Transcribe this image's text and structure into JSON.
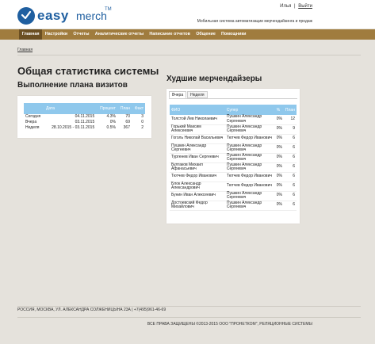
{
  "brand": {
    "easy": "easy",
    "merch": "merch",
    "tm": "TM",
    "primary_color": "#1f5fa0",
    "logo_icon": "check-circle-icon"
  },
  "header": {
    "user_name": "Илья",
    "separator": "|",
    "logout_label": "Выйти",
    "tagline": "Мобильная система автоматизации мерчендайзинга и продаж"
  },
  "nav": {
    "background": "#a07c3e",
    "active_background": "#6b4f22",
    "items": [
      {
        "label": "Главная",
        "active": true
      },
      {
        "label": "Настройки"
      },
      {
        "label": "Отчеты"
      },
      {
        "label": "Аналитические отчеты"
      },
      {
        "label": "Написание отчетов"
      },
      {
        "label": "Общение"
      },
      {
        "label": "Помощники"
      }
    ]
  },
  "breadcrumb": {
    "label": "Главная"
  },
  "page": {
    "title": "Общая статистика системы",
    "plan_title": "Выполнение плана визитов",
    "worst_title": "Худшие мерчендайзеры"
  },
  "plan_table": {
    "header_color": "#8fc8ec",
    "columns": [
      "",
      "Дата",
      "Процент",
      "План",
      "Факт"
    ],
    "rows": [
      {
        "period": "Сегодня",
        "date": "04.11.2015",
        "percent": "4.3%",
        "plan": "70",
        "fact": "3"
      },
      {
        "period": "Вчера",
        "date": "03.11.2015",
        "percent": "0%",
        "plan": "69",
        "fact": "0"
      },
      {
        "period": "Неделя",
        "date": "28.10.2015 - 03.11.2015",
        "percent": "0.5%",
        "plan": "367",
        "fact": "2"
      }
    ]
  },
  "worst": {
    "tabs": [
      {
        "label": "Вчера",
        "active": true
      },
      {
        "label": "Неделя"
      }
    ],
    "columns": [
      "ФИО",
      "Супер",
      "%",
      "План"
    ],
    "rows": [
      {
        "name": "Толстой Лев Николаевич",
        "super": "Пушкин Александр Сергеевич",
        "percent": "0%",
        "plan": "12"
      },
      {
        "name": "Горький Максим Алексеевич",
        "super": "Пушкин Александр Сергеевич",
        "percent": "0%",
        "plan": "9"
      },
      {
        "name": "Гоголь Николай Васильевич",
        "super": "Тютчев Федор Иванович",
        "percent": "0%",
        "plan": "6"
      },
      {
        "name": "Пушкин Александр Сергеевич",
        "super": "Пушкин Александр Сергеевич",
        "percent": "0%",
        "plan": "6"
      },
      {
        "name": "Тургенев Иван Сергеевич",
        "super": "Пушкин Александр Сергеевич",
        "percent": "0%",
        "plan": "6"
      },
      {
        "name": "Булгаков Михаил Афанасьевич",
        "super": "Пушкин Александр Сергеевич",
        "percent": "0%",
        "plan": "6"
      },
      {
        "name": "Тютчев Федор Иванович",
        "super": "Тютчев Федор Иванович",
        "percent": "0%",
        "plan": "6"
      },
      {
        "name": "Блок Александр Александрович",
        "super": "Тютчев Федор Иванович",
        "percent": "0%",
        "plan": "6"
      },
      {
        "name": "Бунин Иван Алексеевич",
        "super": "Пушкин Александр Сергеевич",
        "percent": "0%",
        "plan": "6"
      },
      {
        "name": "Достоевский Федор Михайлович",
        "super": "Пушкин Александр Сергеевич",
        "percent": "0%",
        "plan": "6"
      }
    ]
  },
  "footer": {
    "address": "РОССИЯ, МОСКВА, УЛ. АЛЕКСАНДРА СОЛЖЕНИЦЫНА 23А | +7(495)961-46-69",
    "copyright": "ВСЕ ПРАВА ЗАЩИЩЕНЫ ©2013-2015 ООО \"ПРОНЕТКОМ\", РЕЛЯЦИОННЫЕ СИСТЕМЫ"
  }
}
